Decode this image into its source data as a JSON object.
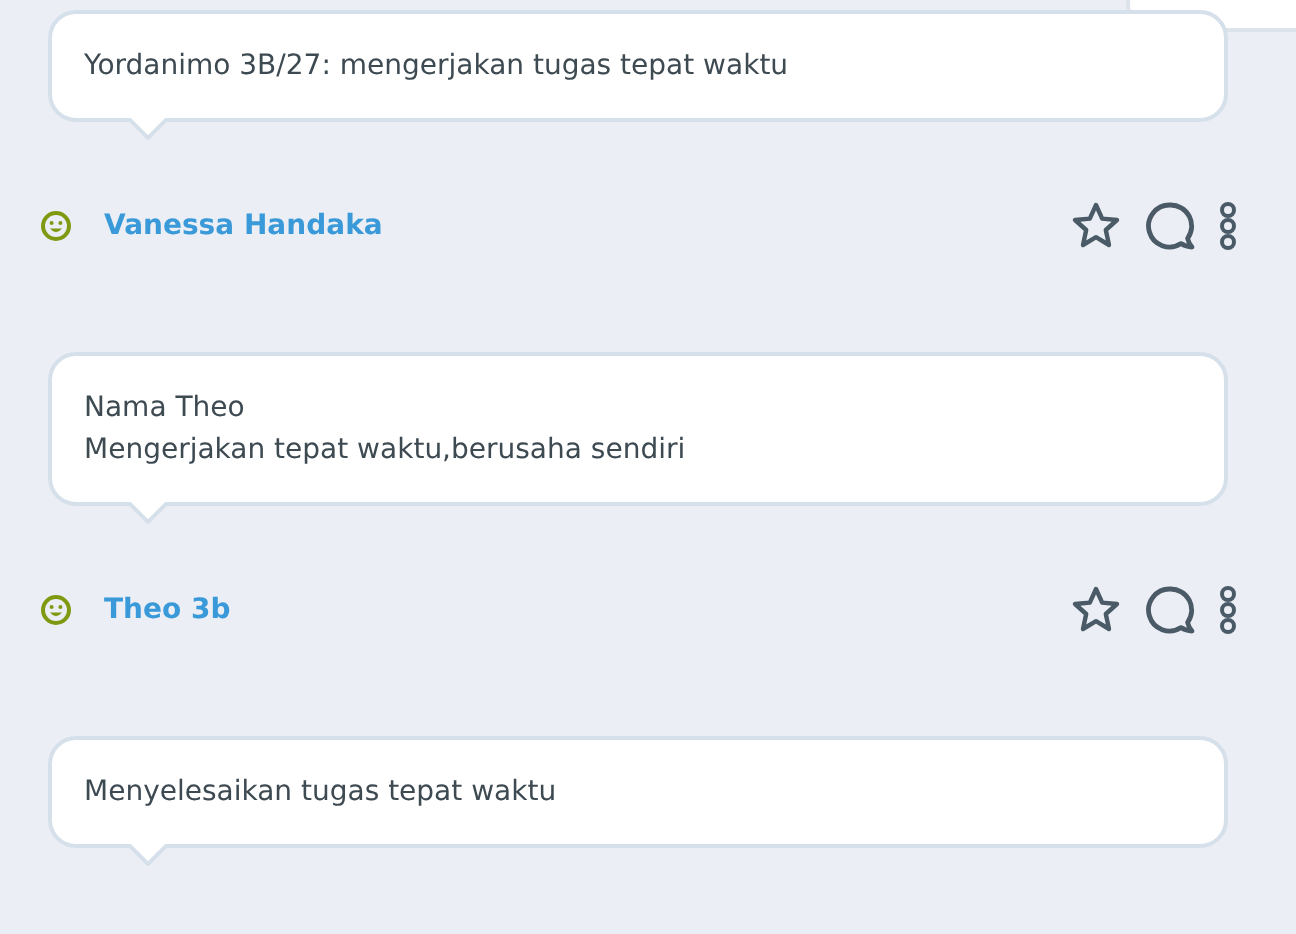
{
  "posts": [
    {
      "lines": [
        "Yordanimo 3B/27: mengerjakan tugas tepat waktu"
      ],
      "author": "Vanessa Handaka"
    },
    {
      "lines": [
        "Nama Theo",
        "Mengerjakan tepat waktu,berusaha sendiri"
      ],
      "author": "Theo 3b"
    },
    {
      "lines": [
        "Menyelesaikan tugas tepat waktu"
      ]
    }
  ]
}
